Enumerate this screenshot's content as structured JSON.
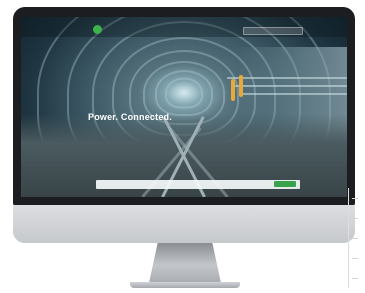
{
  "site": {
    "logo_text": "",
    "utility_links": "",
    "nav_items": [
      "",
      "",
      "",
      "",
      "",
      "",
      "",
      ""
    ]
  },
  "hero": {
    "title": "Power. Connected.",
    "subtitle": ""
  },
  "cta": {
    "text": "",
    "button": ""
  },
  "colors": {
    "brand_green": "#3aa24a",
    "screen_bezel": "#1b1d20",
    "monitor_silver": "#c9ccd0",
    "tunnel_teal": "#3d5a66",
    "accent_orange": "#e8a83a"
  },
  "icons": [
    "logo-circle",
    "search-box"
  ]
}
